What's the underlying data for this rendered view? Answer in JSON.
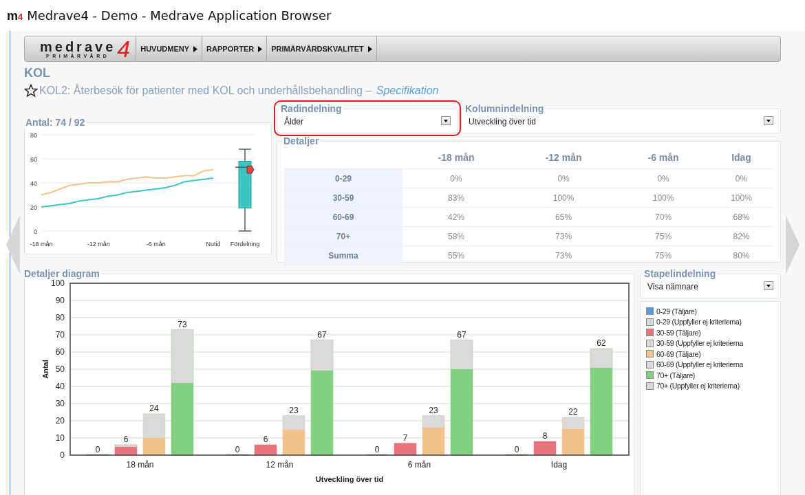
{
  "window": {
    "title": "Medrave4 - Demo - Medrave Application Browser",
    "icon": {
      "letter": "m",
      "number": "4"
    }
  },
  "nav": {
    "logo": {
      "word": "medrave",
      "number": "4",
      "tagline": "PRIMÄRVÅRD"
    },
    "items": [
      {
        "label": "HUVUDMENY"
      },
      {
        "label": "RAPPORTER"
      },
      {
        "label": "PRIMÄRVÅRDSKVALITET"
      }
    ]
  },
  "page": {
    "title": "KOL",
    "subtitle": "KOL2: Återbesök för patienter med KOL och underhållsbehandling – ",
    "link": "Specifikation"
  },
  "overview": {
    "title": "Antal: 74 / 92",
    "boxplot_label": "Fördelning",
    "chart_data": {
      "type": "line",
      "categories": [
        "-18 mån",
        null,
        null,
        null,
        null,
        null,
        "-12 mån",
        null,
        null,
        null,
        null,
        null,
        "-6 mån",
        null,
        null,
        null,
        null,
        null,
        "Nutid"
      ],
      "grid": true,
      "ylim": [
        0,
        80
      ],
      "yticks": [
        0,
        20,
        40,
        60,
        80
      ],
      "series": [
        {
          "color": "#f6c48f",
          "values": [
            30,
            32,
            35,
            38,
            39,
            40,
            40,
            41,
            41,
            43,
            44,
            45,
            44,
            44,
            45,
            46,
            46,
            50,
            51
          ]
        },
        {
          "color": "#45c6c4",
          "values": [
            20,
            21,
            22,
            23,
            25,
            26,
            27,
            29,
            30,
            32,
            33,
            34,
            35,
            36,
            38,
            41,
            42,
            43,
            44
          ]
        }
      ]
    }
  },
  "row_grouping": {
    "label": "Radindelning",
    "value": "Ålder",
    "highlighted": true
  },
  "column_grouping": {
    "label": "Kolumnindelning",
    "value": "Utveckling över tid",
    "highlighted": false
  },
  "details": {
    "title": "Detaljer",
    "columns": [
      "-18 mån",
      "-12 mån",
      "-6 mån",
      "Idag"
    ],
    "rows": [
      {
        "label": "0-29",
        "cells": [
          "0%",
          "0%",
          "0%",
          "0%"
        ]
      },
      {
        "label": "30-59",
        "cells": [
          "83%",
          "100%",
          "100%",
          "100%"
        ]
      },
      {
        "label": "60-69",
        "cells": [
          "42%",
          "65%",
          "70%",
          "68%"
        ]
      },
      {
        "label": "70+",
        "cells": [
          "58%",
          "73%",
          "75%",
          "82%"
        ]
      },
      {
        "label": "Summa",
        "cells": [
          "55%",
          "73%",
          "75%",
          "80%"
        ]
      }
    ]
  },
  "diagram": {
    "title": "Detaljer diagram",
    "chart_data": {
      "type": "bar",
      "grid": true,
      "data_labels": true,
      "xlabel": "Utveckling över tid",
      "ylabel": "Antal",
      "categories": [
        "18 mån",
        "12 mån",
        "6 mån",
        "Idag"
      ],
      "ylim": [
        0,
        100
      ],
      "yticks": [
        0,
        10,
        20,
        30,
        40,
        50,
        60,
        70,
        80,
        90,
        100
      ],
      "series": [
        {
          "color": "#5b9bd5",
          "values": [
            0,
            0,
            0,
            0
          ]
        },
        {
          "color": "#e8737b",
          "values": [
            6,
            6,
            7,
            8
          ]
        },
        {
          "color": "#f2c18c",
          "values": [
            24,
            23,
            23,
            22
          ]
        },
        {
          "color": "#82cf82",
          "values": [
            73,
            67,
            67,
            62
          ]
        }
      ]
    },
    "legend": [
      {
        "label": "0-29 (Täljare)",
        "color": "#5b9bd5"
      },
      {
        "label": "0-29 (Uppfyller ej kriterierna)",
        "color": "#d9d9d9"
      },
      {
        "label": "30-59 (Täljare)",
        "color": "#e8737b"
      },
      {
        "label": "30-59 (Uppfyller ej kriterierna",
        "color": "#d9d9d9"
      },
      {
        "label": "60-69 (Täljare)",
        "color": "#f2c18c"
      },
      {
        "label": "60-69 (Uppfyller ej kriterierna",
        "color": "#d9d9d9"
      },
      {
        "label": "70+ (Täljare)",
        "color": "#82cf82"
      },
      {
        "label": "70+ (Uppfyller ej kriterierna)",
        "color": "#d9d9d9"
      }
    ]
  },
  "stack_grouping": {
    "label": "Stapelindelning",
    "value": "Visa nämnare"
  }
}
